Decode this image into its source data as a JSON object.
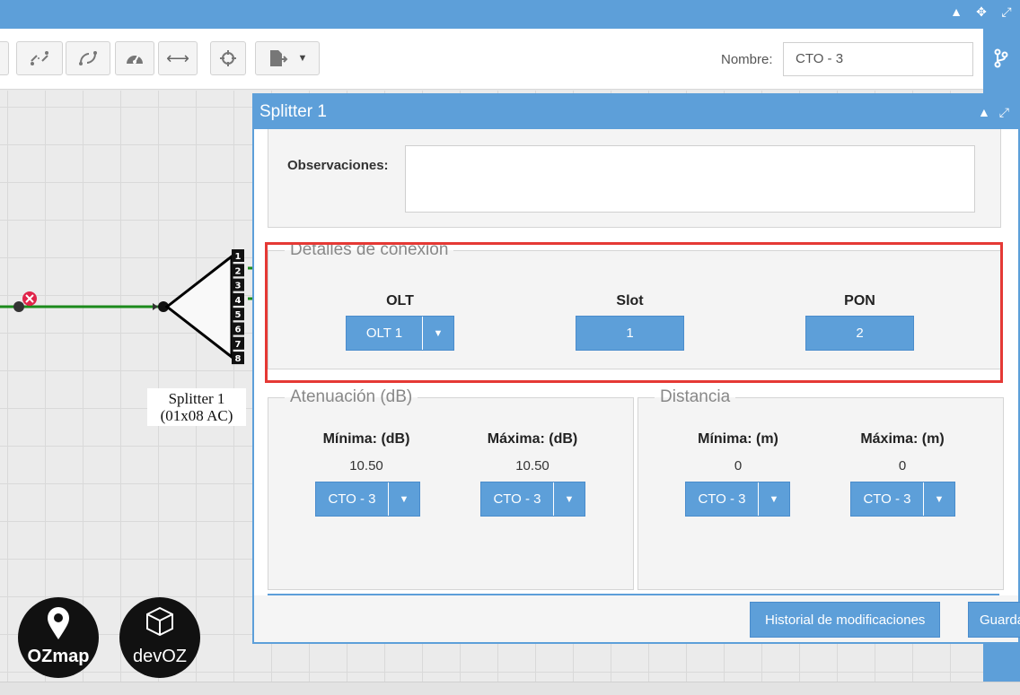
{
  "toolbar": {
    "nombre_label": "Nombre:",
    "nombre_value": "CTO - 3",
    "buttons": [
      "unlink-icon",
      "unlink-alt-icon",
      "gauge-icon",
      "arrows-horizontal-icon",
      "crosshair-icon",
      "export-icon"
    ]
  },
  "canvas": {
    "splitter_label_line1": "Splitter 1",
    "splitter_label_line2": "(01x08 AC)",
    "ports": [
      "1",
      "2",
      "3",
      "4",
      "5",
      "6",
      "7",
      "8"
    ],
    "logos": {
      "ozmap": "OZmap",
      "devoz": "devOZ"
    }
  },
  "dialog": {
    "title": "Splitter 1",
    "observaciones_label": "Observaciones:",
    "observaciones_value": "",
    "conexion": {
      "legend": "Detalles de conexión",
      "olt_label": "OLT",
      "olt_value": "OLT 1",
      "slot_label": "Slot",
      "slot_value": "1",
      "pon_label": "PON",
      "pon_value": "2"
    },
    "atenuacion": {
      "legend": "Atenuación (dB)",
      "min_label": "Mínima: (dB)",
      "min_value": "10.50",
      "min_select": "CTO - 3",
      "max_label": "Máxima: (dB)",
      "max_value": "10.50",
      "max_select": "CTO - 3"
    },
    "distancia": {
      "legend": "Distancia",
      "min_label": "Mínima: (m)",
      "min_value": "0",
      "min_select": "CTO - 3",
      "max_label": "Máxima: (m)",
      "max_value": "0",
      "max_select": "CTO - 3"
    },
    "footer": {
      "historial": "Historial de modificaciones",
      "guardar": "Guardar"
    }
  },
  "colors": {
    "accent": "#5d9fd9",
    "highlight": "#e53935",
    "link_line": "#1b8a1b"
  }
}
